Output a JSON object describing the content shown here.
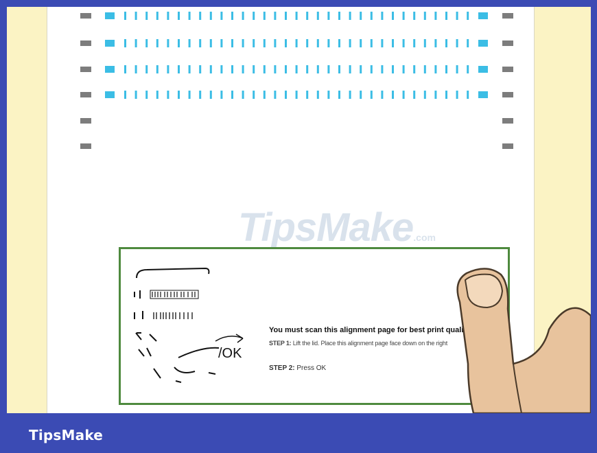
{
  "watermark": {
    "text": "TipsMake",
    "suffix": ".com"
  },
  "scan_page": {
    "headline": "You must scan this alignment page for best print quality:",
    "step1_label": "STEP 1:",
    "step1_text": "Lift the lid. Place this alignment page face down on the right",
    "step2_label": "STEP 2:",
    "step2_text": "Press OK"
  },
  "footer": {
    "brand": "TipsMake"
  },
  "colors": {
    "frame": "#3b4bb4",
    "background": "#fbf3c4",
    "paper": "#ffffff",
    "cyan_marks": "#3bbde5",
    "gray_marks": "#7d7d7d",
    "scan_border": "#4e8a3e",
    "skin": "#e8c39d"
  }
}
